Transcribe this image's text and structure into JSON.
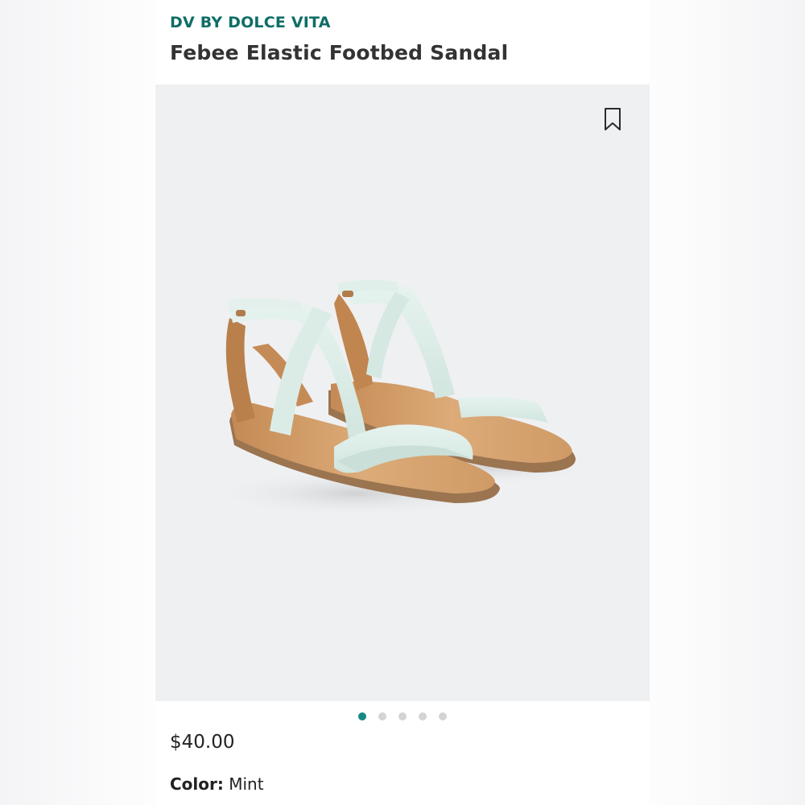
{
  "product": {
    "brand": "DV BY DOLCE VITA",
    "name": "Febee Elastic Footbed Sandal",
    "price": "$40.00",
    "color_label": "Color:",
    "color_value": "Mint"
  },
  "gallery": {
    "image_count": 5,
    "active_index": 0,
    "bookmark_icon": "bookmark-icon"
  },
  "colors": {
    "brand": "#0e6e66",
    "active_dot": "#138a86",
    "inactive_dot": "#d3d4d6",
    "strap": "#dfeeea",
    "footbed": "#d6a26e"
  }
}
